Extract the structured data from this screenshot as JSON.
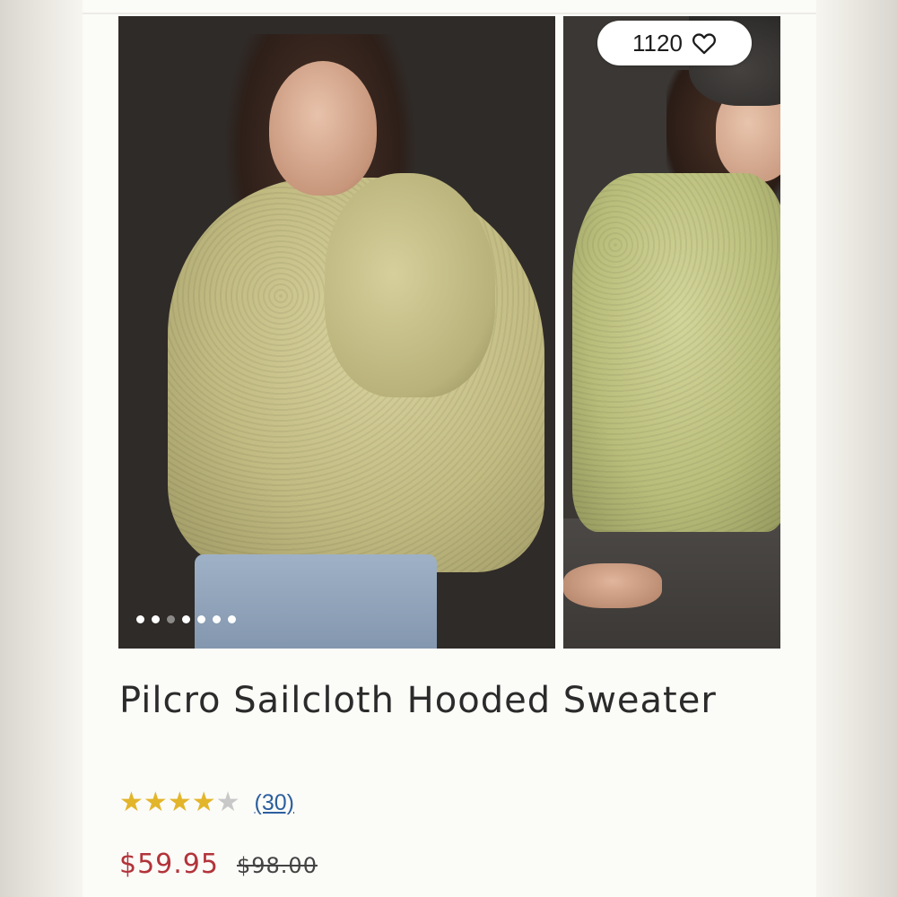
{
  "product": {
    "title": "Pilcro Sailcloth Hooded Sweater",
    "likes": "1120",
    "rating": {
      "value": 4,
      "max": 5,
      "count_label": "(30)"
    },
    "price": {
      "sale": "$59.95",
      "original": "$98.00"
    },
    "gallery": {
      "dot_count": 7,
      "active_index": 0
    }
  },
  "colors": {
    "star_filled": "#e3b52b",
    "star_empty": "#c8c8c8",
    "sale_price": "#b2343a",
    "link": "#2c5f9e"
  },
  "icons": {
    "likes": "heart-outline-icon",
    "rating": "star-icon"
  }
}
